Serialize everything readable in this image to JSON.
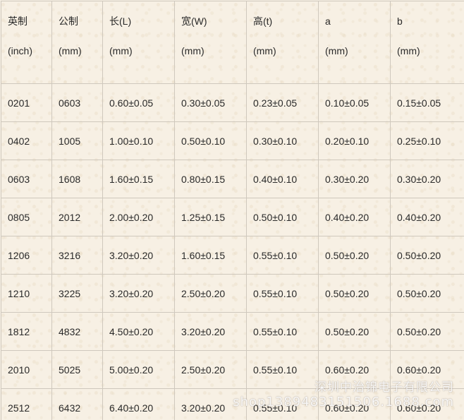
{
  "table": {
    "headers": [
      {
        "name": "英制",
        "unit": "(inch)"
      },
      {
        "name": "公制",
        "unit": "(mm)"
      },
      {
        "name": "长(L)",
        "unit": "(mm)"
      },
      {
        "name": "宽(W)",
        "unit": "(mm)"
      },
      {
        "name": "高(t)",
        "unit": "(mm)"
      },
      {
        "name": "a",
        "unit": "(mm)"
      },
      {
        "name": "b",
        "unit": "(mm)"
      }
    ],
    "rows": [
      [
        "0201",
        "0603",
        "0.60±0.05",
        "0.30±0.05",
        "0.23±0.05",
        "0.10±0.05",
        "0.15±0.05"
      ],
      [
        "0402",
        "1005",
        "1.00±0.10",
        "0.50±0.10",
        "0.30±0.10",
        "0.20±0.10",
        "0.25±0.10"
      ],
      [
        "0603",
        "1608",
        "1.60±0.15",
        "0.80±0.15",
        "0.40±0.10",
        "0.30±0.20",
        "0.30±0.20"
      ],
      [
        "0805",
        "2012",
        "2.00±0.20",
        "1.25±0.15",
        "0.50±0.10",
        "0.40±0.20",
        "0.40±0.20"
      ],
      [
        "1206",
        "3216",
        "3.20±0.20",
        "1.60±0.15",
        "0.55±0.10",
        "0.50±0.20",
        "0.50±0.20"
      ],
      [
        "1210",
        "3225",
        "3.20±0.20",
        "2.50±0.20",
        "0.55±0.10",
        "0.50±0.20",
        "0.50±0.20"
      ],
      [
        "1812",
        "4832",
        "4.50±0.20",
        "3.20±0.20",
        "0.55±0.10",
        "0.50±0.20",
        "0.50±0.20"
      ],
      [
        "2010",
        "5025",
        "5.00±0.20",
        "2.50±0.20",
        "0.55±0.10",
        "0.60±0.20",
        "0.60±0.20"
      ],
      [
        "2512",
        "6432",
        "6.40±0.20",
        "3.20±0.20",
        "0.55±0.10",
        "0.60±0.20",
        "0.60±0.20"
      ]
    ]
  },
  "watermark": {
    "company": "深圳中治锦电子有限公司",
    "url": "shop1389483151506.1688.com"
  },
  "colors": {
    "background": "#f7f0e4",
    "border": "#cfc8bd",
    "text": "#2a2a2a"
  }
}
